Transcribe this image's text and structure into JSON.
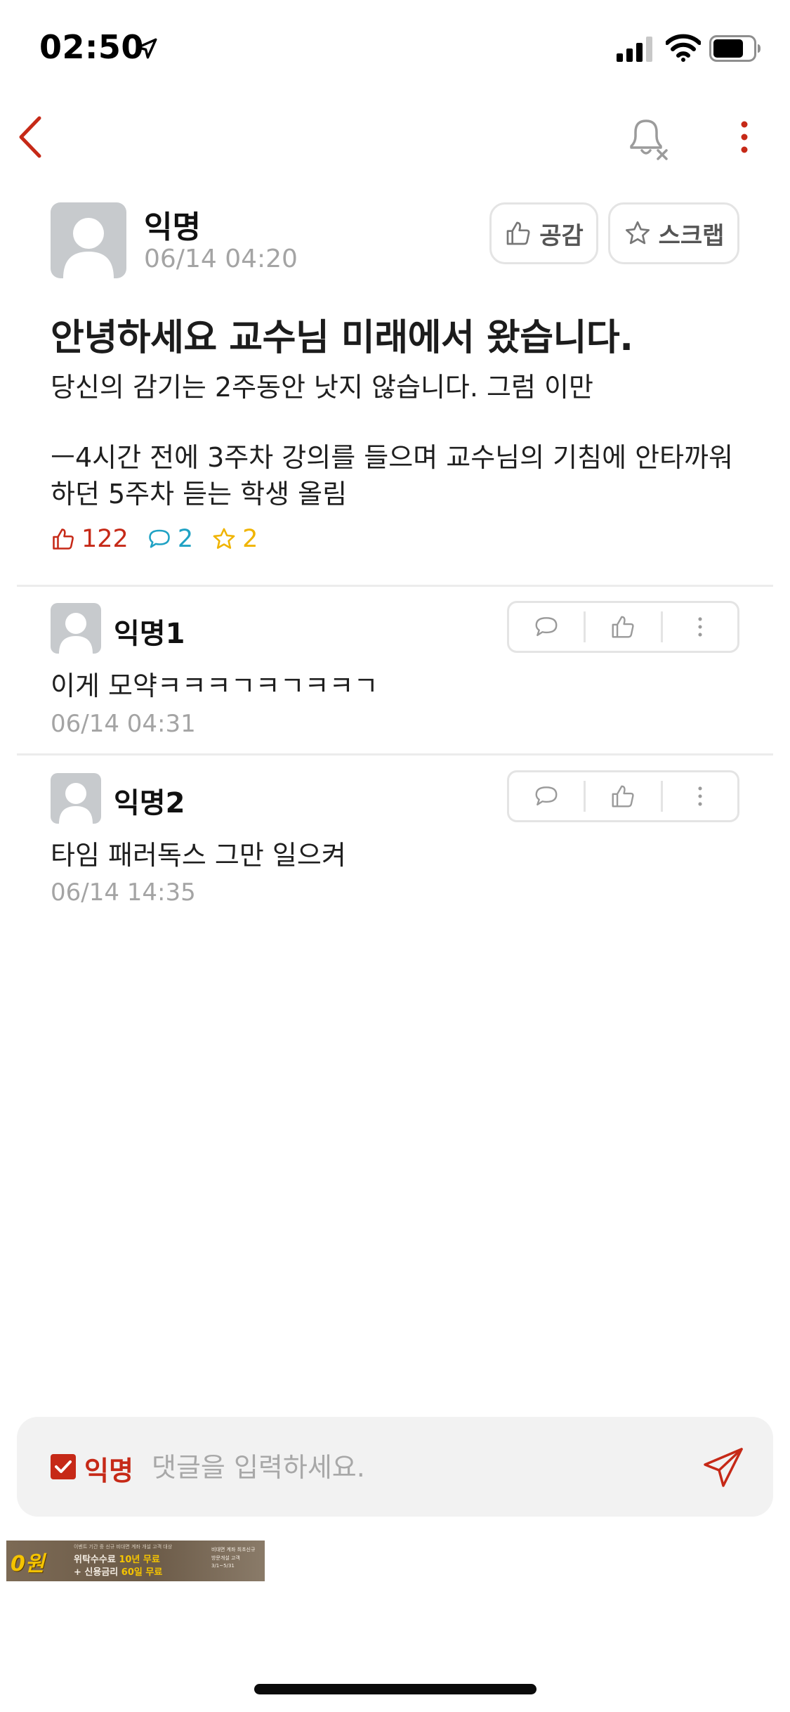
{
  "status_bar": {
    "time": "02:50"
  },
  "post": {
    "author": "익명",
    "time": "06/14 04:20",
    "like_button_label": "공감",
    "scrap_button_label": "스크랩",
    "title": "안녕하세요 교수님 미래에서 왔습니다.",
    "body_line1": "당신의 감기는 2주동안 낫지 않습니다. 그럼 이만",
    "body_line2": "ㅡ4시간 전에 3주차 강의를 들으며 교수님의 기침에 안타까워하던 5주차 듣는 학생 올림",
    "stats": {
      "likes": "122",
      "comments": "2",
      "scraps": "2"
    }
  },
  "comments": [
    {
      "author": "익명1",
      "text": "이게 모약ㅋㅋㅋㄱㅋㄱㅋㅋㄱ",
      "time": "06/14 04:31"
    },
    {
      "author": "익명2",
      "text": "타임 패러독스 그만 일으켜",
      "time": "06/14 14:35"
    }
  ],
  "comment_bar": {
    "anonymous_label": "익명",
    "placeholder": "댓글을 입력하세요."
  },
  "ad": {
    "badge": "0원",
    "line1": "이벤트 기간 중 신규 비대면 계좌 개설 고객 대상",
    "line2_a": "위탁수수료 ",
    "line2_b": "10년 무료",
    "line3_a": "+ 신용금리 ",
    "line3_b": "60일 무료",
    "right1": "비대면 계좌 최초신규",
    "right2": "방문개설 고객",
    "right3": "3/1~5/31"
  },
  "colors": {
    "accent": "#c62917",
    "comment_accent": "#1fa2c4",
    "scrap_accent": "#f0b400",
    "muted_text": "#a4a4a4"
  }
}
